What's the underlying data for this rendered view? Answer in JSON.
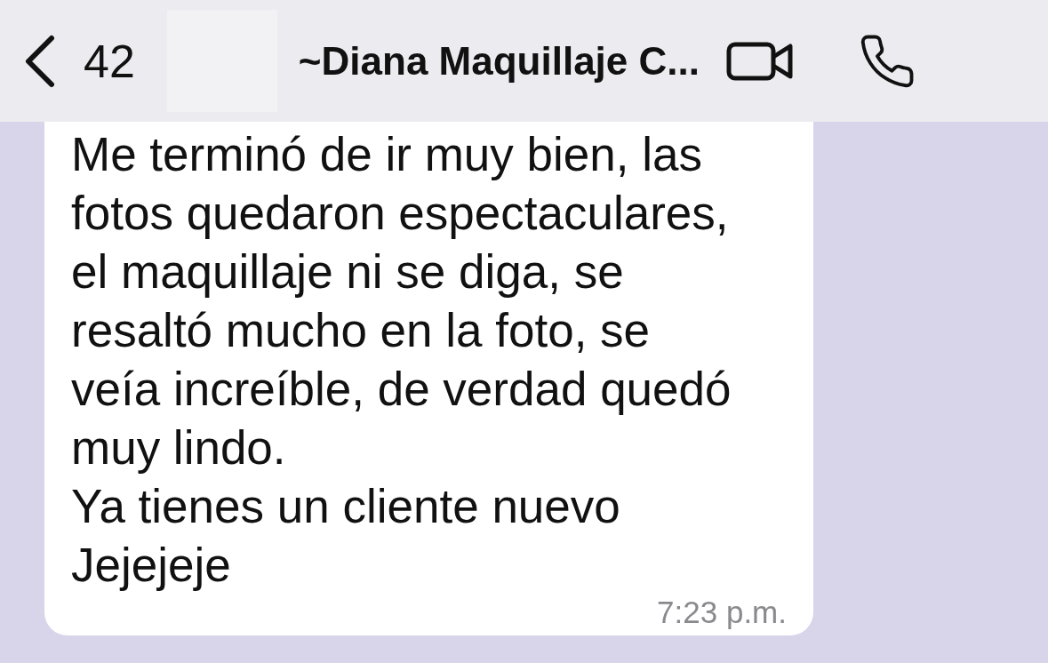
{
  "header": {
    "back_count": "42",
    "title": "~Diana Maquillaje C..."
  },
  "message": {
    "lines": [
      "Me terminó de ir muy bien, las",
      "fotos quedaron espectaculares,",
      "el maquillaje ni se diga, se",
      "resaltó mucho en la foto, se",
      "veía increíble, de verdad quedó",
      "muy lindo.",
      "Ya tienes un cliente nuevo",
      "Jejejeje"
    ],
    "time": "7:23 p.m."
  }
}
